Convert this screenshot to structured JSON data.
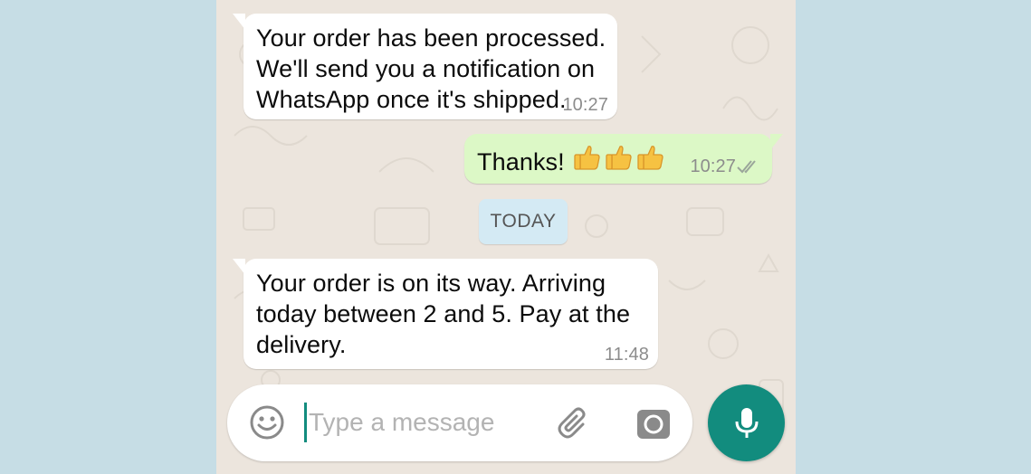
{
  "colors": {
    "outer_background": "#c6dde5",
    "chat_background": "#ece5dd",
    "incoming_bubble": "#ffffff",
    "outgoing_bubble": "#dcf8c6",
    "date_chip": "#d4eaf4",
    "accent": "#128c7e",
    "timestamp": "#8c8c8c"
  },
  "messages": [
    {
      "direction": "incoming",
      "text": "Your order has been processed.\nWe'll send you a notification on\nWhatsApp once it's shipped.",
      "time": "10:27"
    },
    {
      "direction": "outgoing",
      "text": "Thanks!",
      "emoji": [
        "thumbs-up",
        "thumbs-up",
        "thumbs-up"
      ],
      "time": "10:27",
      "status_icon": "double-check-icon"
    },
    {
      "direction": "incoming",
      "text": "Your order is on its way. Arriving\ntoday between 2 and 5. Pay at the\ndelivery.",
      "time": "11:48"
    }
  ],
  "date_separator": "TODAY",
  "composer": {
    "placeholder": "Type a message",
    "value": "",
    "icons": {
      "emoji": "smiley-icon",
      "attach": "paperclip-icon",
      "camera": "camera-icon",
      "mic": "microphone-icon"
    }
  }
}
